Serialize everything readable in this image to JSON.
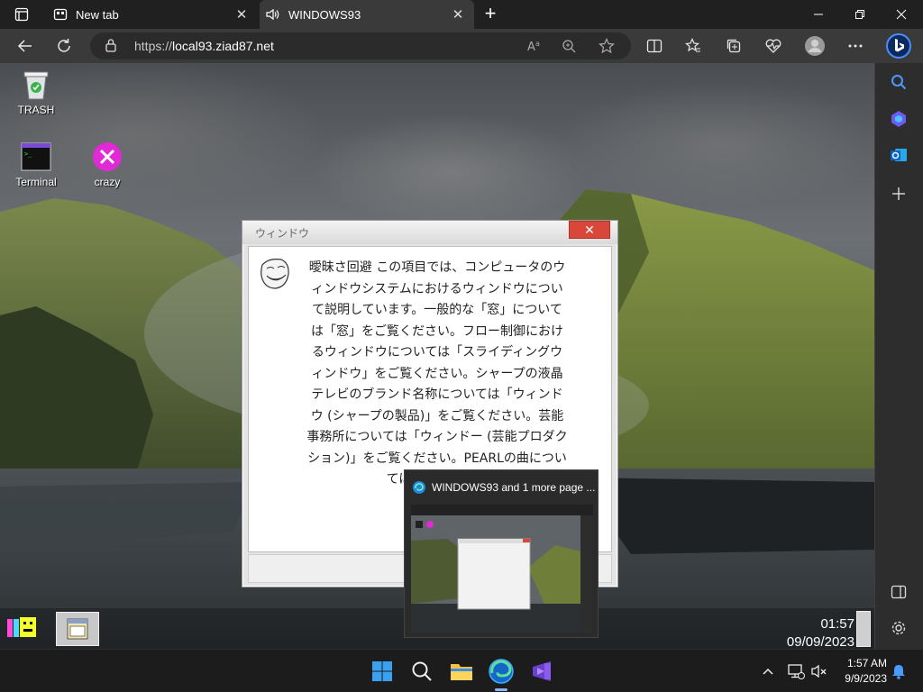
{
  "browser": {
    "tabs": [
      {
        "label": "New tab",
        "icon": "new-tab-icon",
        "active": false
      },
      {
        "label": "WINDOWS93",
        "icon": "audio-playing-icon",
        "active": true
      }
    ],
    "url": {
      "scheme": "https://",
      "host": "local93.ziad87.net"
    }
  },
  "desktop": {
    "icons": [
      {
        "label": "TRASH",
        "icon": "recycle-bin-icon"
      },
      {
        "label": "Terminal",
        "icon": "terminal-icon"
      },
      {
        "label": "crazy",
        "icon": "crazy-x-icon"
      }
    ]
  },
  "dialog": {
    "title": "ウィンドウ",
    "body": "曖昧さ回避 この項目では、コンピュータのウィンドウシステムにおけるウィンドウについて説明しています。一般的な「窓」については「窓」をご覧ください。フロー制御におけるウィンドウについては「スライディングウィンドウ」をご覧ください。シャープの液晶テレビのブランド名称については「ウィンドウ (シャープの製品)」をご覧ください。芸能事務所については「ウィンドー (芸能プロダクション)」をご覧ください。PEARLの曲については、「WINDOW"
  },
  "w93taskbar": {
    "time": "01:57",
    "date": "09/09/2023"
  },
  "thumbnail": {
    "title": "WINDOWS93 and 1 more page ..."
  },
  "system": {
    "time": "1:57 AM",
    "date": "9/9/2023"
  },
  "colors": {
    "dialog_close": "#d9463a",
    "edge_accent": "#1a73e8",
    "taskbar_bg": "#1c1c1c"
  }
}
